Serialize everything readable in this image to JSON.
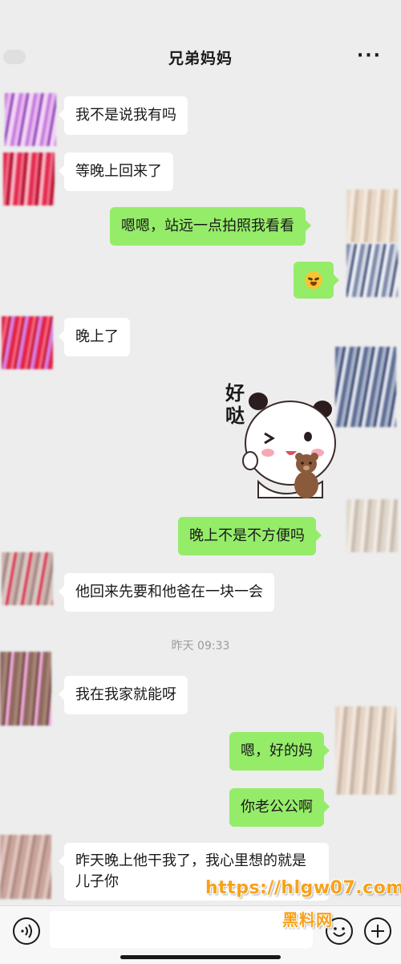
{
  "header": {
    "title": "兄弟妈妈",
    "more_icon": "more-dots-icon"
  },
  "messages": [
    {
      "side": "in",
      "text": "我不是说我有吗"
    },
    {
      "side": "in",
      "text": "等晚上回来了"
    },
    {
      "side": "out",
      "text": "嗯嗯，站远一点拍照我看看"
    },
    {
      "side": "out",
      "emoji": "crying-laughing-emoji"
    },
    {
      "side": "in",
      "text": "晚上了"
    },
    {
      "side": "out",
      "sticker": "panda-holding-bear-sticker",
      "sticker_text": "好哒"
    },
    {
      "side": "out",
      "text": "晚上不是不方便吗"
    },
    {
      "side": "in",
      "text": "他回来先要和他爸在一块一会"
    },
    {
      "side": "in",
      "text": "我在我家就能呀"
    },
    {
      "side": "out",
      "text": "嗯，好的妈"
    },
    {
      "side": "out",
      "text": "你老公公啊"
    },
    {
      "side": "in",
      "text": "昨天晚上他干我了，我心里想的就是儿子你"
    }
  ],
  "timestamp": "昨天 09:33",
  "input_bar": {
    "placeholder": "",
    "voice_icon": "voice-icon",
    "emoji_icon": "smile-icon",
    "add_icon": "plus-icon"
  },
  "watermark": {
    "url": "https://hlgw07.com",
    "name": "黑料网"
  },
  "colors": {
    "background": "#ededed",
    "incoming_bubble": "#ffffff",
    "outgoing_bubble": "#95ec69",
    "timestamp": "#9b9b9b",
    "watermark": "#f7a21a"
  }
}
